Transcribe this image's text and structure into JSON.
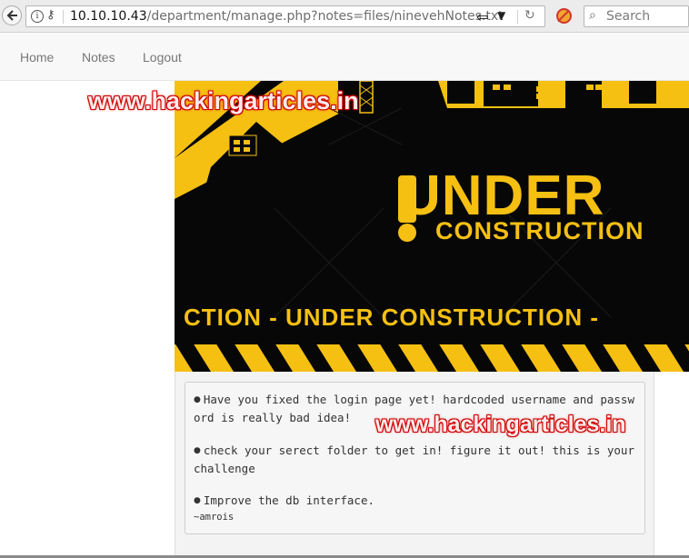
{
  "browser": {
    "url_host": "10.10.10.43",
    "url_path": "/department/manage.php?notes=files/ninevehNotes.txt",
    "search_placeholder": "Search"
  },
  "nav": {
    "items": [
      {
        "label": "Home"
      },
      {
        "label": "Notes"
      },
      {
        "label": "Logout"
      }
    ]
  },
  "banner": {
    "title": "UNDER",
    "subtitle": "CONSTRUCTION",
    "ticker": "CTION - UNDER CONSTRUCTION -"
  },
  "notes": {
    "items": [
      "Have you fixed the login page yet! hardcoded username and password is really bad idea!",
      "check your serect folder to get in! figure it out! this is your challenge",
      "Improve the db interface."
    ],
    "signature": "~amrois"
  },
  "watermark": "www.hackingarticles.in",
  "colors": {
    "banner_yellow": "#f5c012",
    "banner_black": "#070707",
    "watermark_red": "#d40000"
  }
}
